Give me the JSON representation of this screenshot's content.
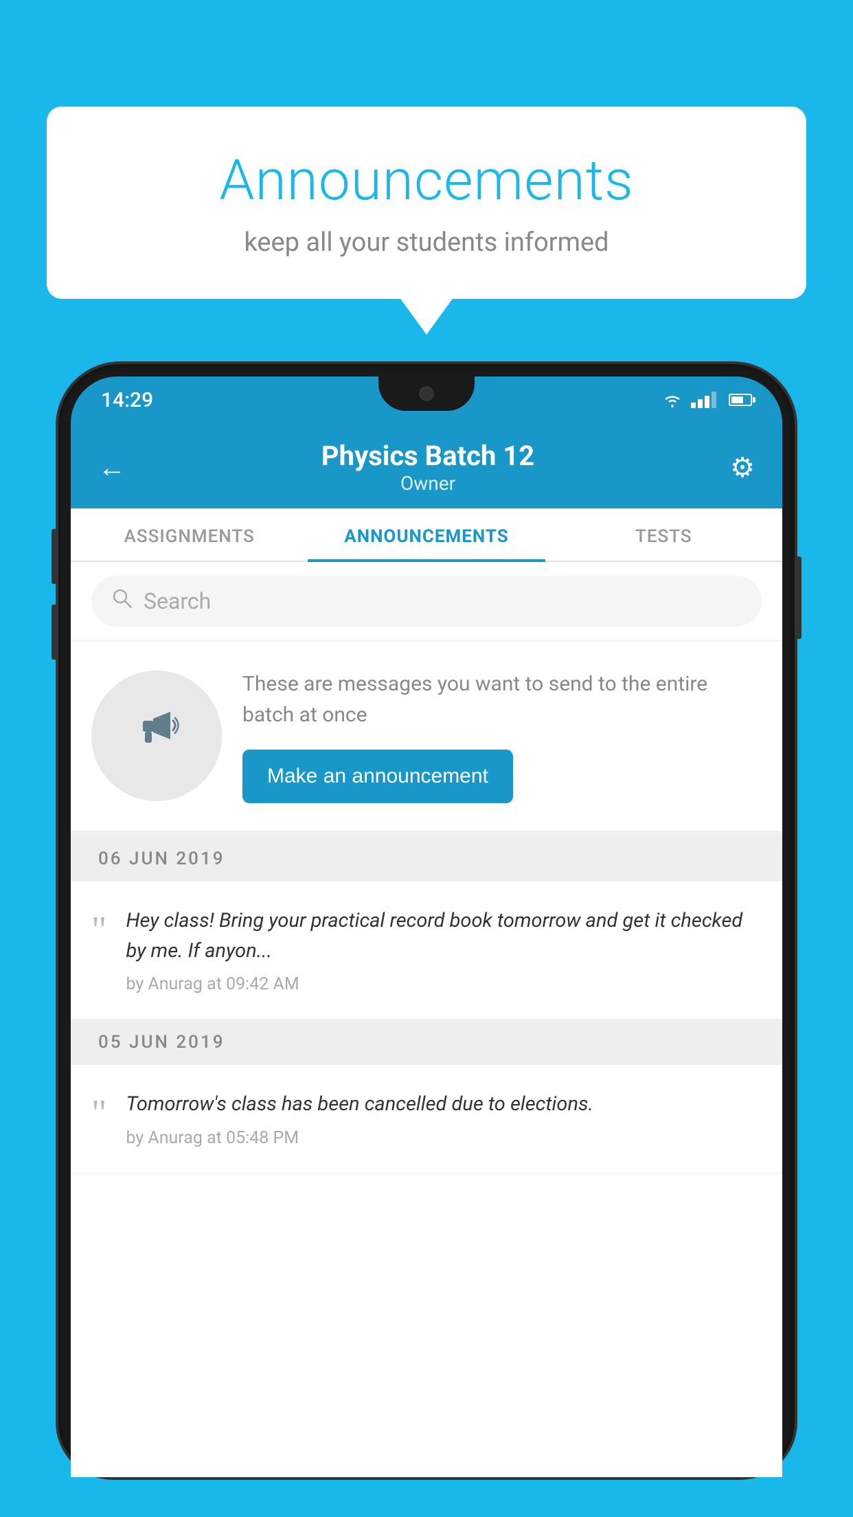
{
  "page": {
    "background_color": "#1ab7ea"
  },
  "speech_bubble": {
    "title": "Announcements",
    "subtitle": "keep all your students informed"
  },
  "status_bar": {
    "time": "14:29",
    "wifi": "▼",
    "signal": "▲",
    "battery": "battery"
  },
  "header": {
    "title": "Physics Batch 12",
    "subtitle": "Owner",
    "back_label": "←",
    "gear_label": "⚙"
  },
  "tabs": [
    {
      "label": "ASSIGNMENTS",
      "active": false
    },
    {
      "label": "ANNOUNCEMENTS",
      "active": true
    },
    {
      "label": "TESTS",
      "active": false
    }
  ],
  "search": {
    "placeholder": "Search"
  },
  "announcement_prompt": {
    "description": "These are messages you want to send to the entire batch at once",
    "button_label": "Make an announcement"
  },
  "date_groups": [
    {
      "date": "06  JUN  2019",
      "messages": [
        {
          "text": "Hey class! Bring your practical record book tomorrow and get it checked by me. If anyon...",
          "meta": "by Anurag at 09:42 AM"
        }
      ]
    },
    {
      "date": "05  JUN  2019",
      "messages": [
        {
          "text": "Tomorrow's class has been cancelled due to elections.",
          "meta": "by Anurag at 05:48 PM"
        }
      ]
    }
  ]
}
